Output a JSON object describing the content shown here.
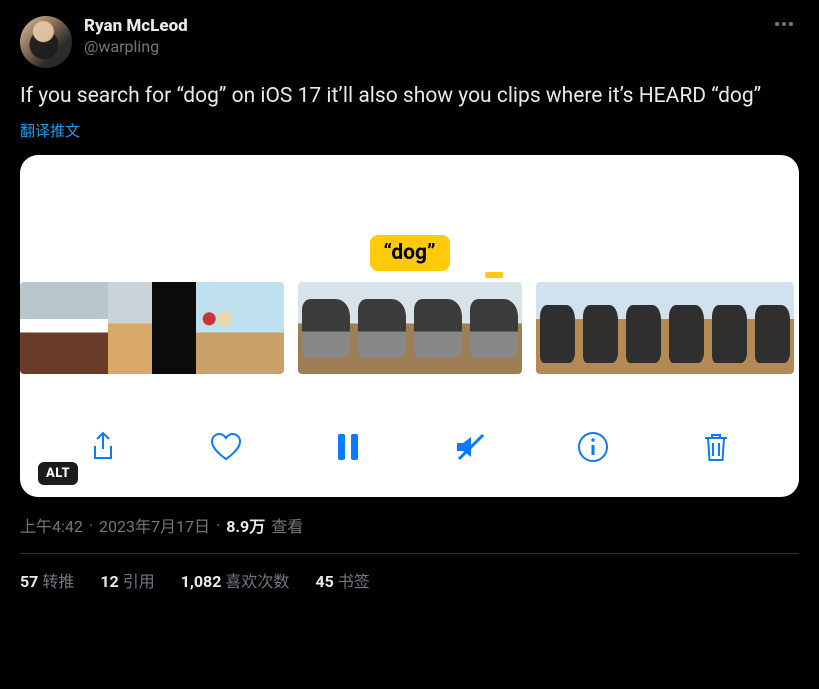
{
  "author": {
    "display_name": "Ryan McLeod",
    "handle": "@warpling"
  },
  "tweet_text": "If you search for “dog” on iOS 17 it’ll also show you clips where it’s HEARD “dog”",
  "translate_label": "翻译推文",
  "media": {
    "bubble_text": "“dog”",
    "alt_badge": "ALT"
  },
  "meta": {
    "time": "上午4:42",
    "sep1": " · ",
    "date": "2023年7月17日",
    "sep2": " · ",
    "views_value": "8.9万",
    "views_label": " 查看"
  },
  "stats": {
    "retweets_n": "57",
    "retweets_label": "转推",
    "quotes_n": "12",
    "quotes_label": "引用",
    "likes_n": "1,082",
    "likes_label": "喜欢次数",
    "bookmarks_n": "45",
    "bookmarks_label": "书签"
  }
}
